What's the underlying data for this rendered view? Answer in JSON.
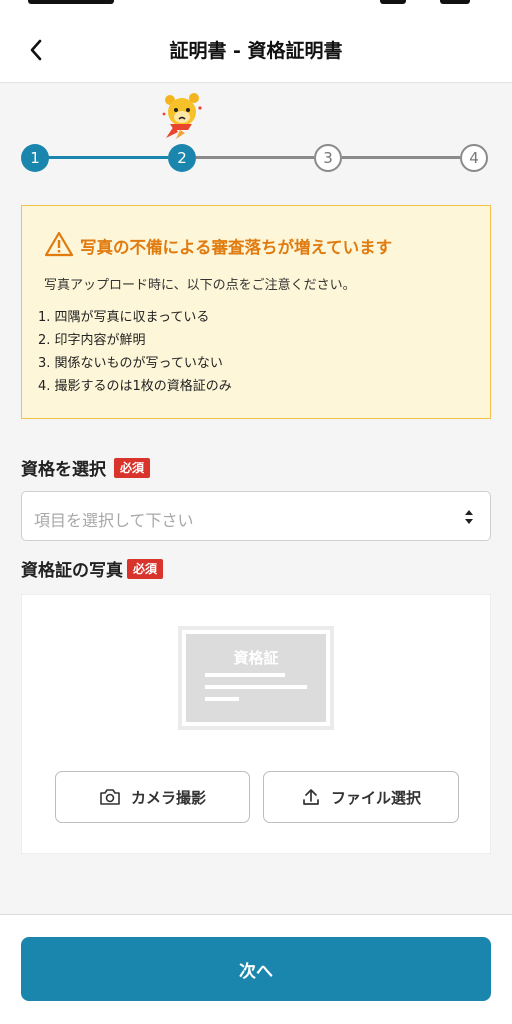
{
  "header": {
    "title": "証明書 - 資格証明書"
  },
  "stepper": {
    "steps": [
      "1",
      "2",
      "3",
      "4"
    ],
    "current_step": 2
  },
  "notice": {
    "title": "写真の不備による審査落ちが増えています",
    "description": "写真アップロード時に、以下の点をご注意ください。",
    "items": [
      "1. 四隅が写真に収まっている",
      "2. 印字内容が鮮明",
      "3. 関係ないものが写っていない",
      "4. 撮影するのは1枚の資格証のみ"
    ]
  },
  "qualification": {
    "label": "資格を選択",
    "required_badge": "必須",
    "placeholder": "項目を選択して下さい"
  },
  "photo": {
    "label": "資格証の写真",
    "required_badge": "必須",
    "illustration_label": "資格証",
    "camera_button": "カメラ撮影",
    "file_button": "ファイル選択"
  },
  "footer": {
    "next_button": "次へ"
  },
  "colors": {
    "primary": "#1a86ad",
    "warning_text": "#e07b10",
    "warning_bg": "#fdf6d8",
    "required_badge": "#d9342b"
  }
}
